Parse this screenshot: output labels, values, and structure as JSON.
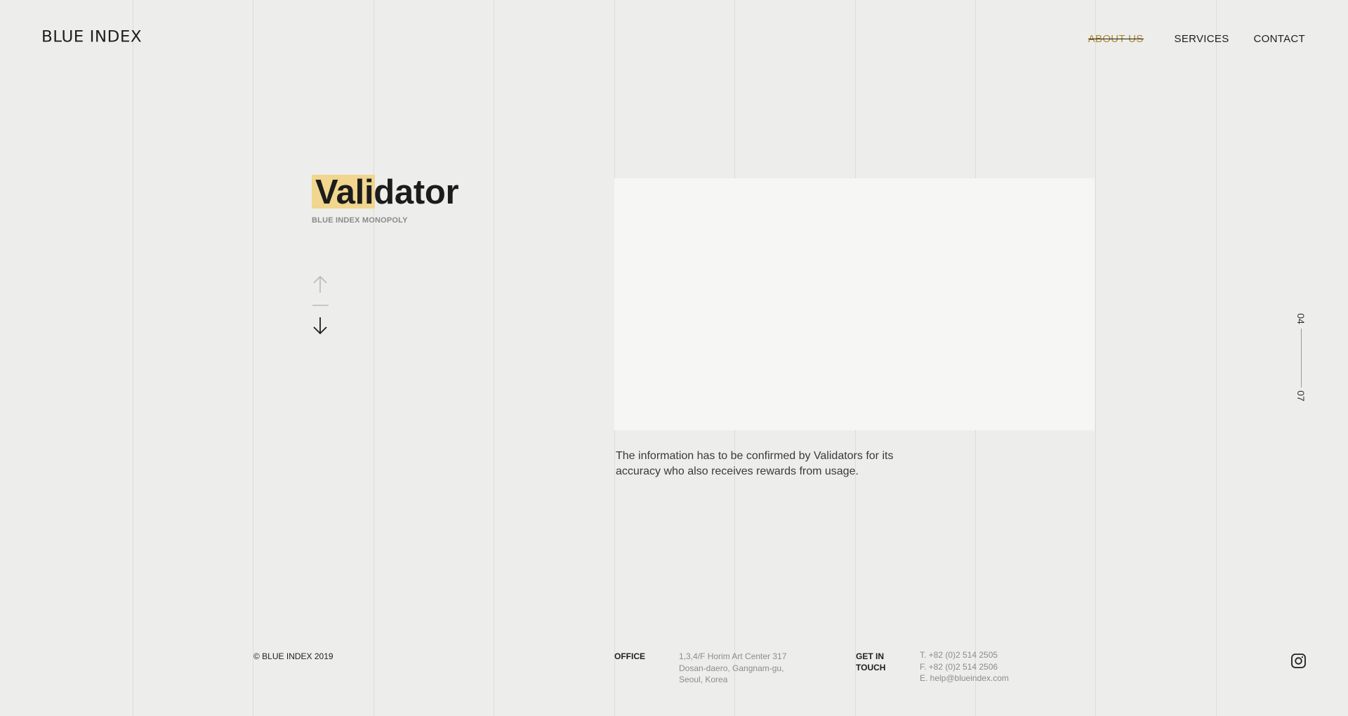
{
  "header": {
    "logo": "BLUE INDEX",
    "nav": [
      {
        "label": "ABOUT US",
        "active": true
      },
      {
        "label": "SERVICES",
        "active": false
      },
      {
        "label": "CONTACT",
        "active": false
      }
    ]
  },
  "hero": {
    "title": "Validator",
    "subtitle": "BLUE INDEX MONOPOLY",
    "description": "The information has to be confirmed by Validators for its accuracy who also receives rewards from usage."
  },
  "pager": {
    "current": "04",
    "total": "07"
  },
  "footer": {
    "copyright": "© BLUE INDEX 2019",
    "office_label": "OFFICE",
    "office_lines": [
      "1,3,4/F Horim Art Center 317",
      "Dosan-daero, Gangnam-gu,",
      "Seoul, Korea"
    ],
    "touch_label_1": "GET IN",
    "touch_label_2": "TOUCH",
    "touch_lines": [
      "T. +82 (0)2 514 2505",
      "F. +82 (0)2 514 2506",
      "E. help@blueindex.com"
    ]
  },
  "icons": {
    "arrow_up": "arrow-up-icon",
    "arrow_down": "arrow-down-icon",
    "instagram": "instagram-icon"
  },
  "colors": {
    "background": "#ededeb",
    "highlight": "#f0d68e",
    "active_nav": "#b08a2c",
    "panel": "#f6f6f5"
  }
}
